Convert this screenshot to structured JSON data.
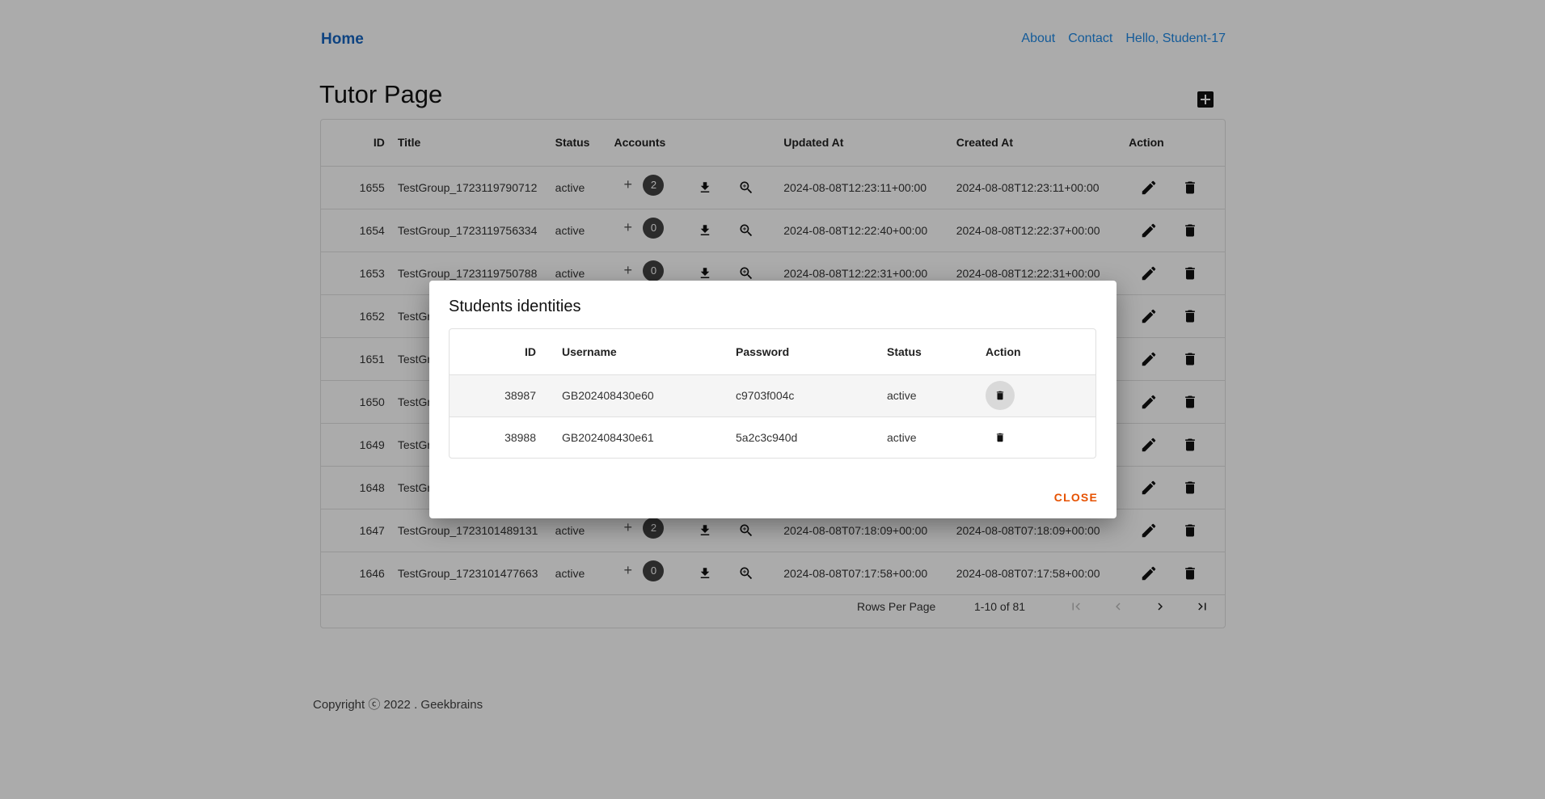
{
  "nav": {
    "home": "Home",
    "about": "About",
    "contact": "Contact",
    "greeting": "Hello, Student-17"
  },
  "page_title": "Tutor Page",
  "table": {
    "headers": {
      "id": "ID",
      "title": "Title",
      "status": "Status",
      "accounts": "Accounts",
      "updated": "Updated At",
      "created": "Created At",
      "action": "Action"
    },
    "rows": [
      {
        "id": "1655",
        "title": "TestGroup_1723119790712",
        "status": "active",
        "count": "2",
        "updated": "2024-08-08T12:23:11+00:00",
        "created": "2024-08-08T12:23:11+00:00"
      },
      {
        "id": "1654",
        "title": "TestGroup_1723119756334",
        "status": "active",
        "count": "0",
        "updated": "2024-08-08T12:22:40+00:00",
        "created": "2024-08-08T12:22:37+00:00"
      },
      {
        "id": "1653",
        "title": "TestGroup_1723119750788",
        "status": "active",
        "count": "0",
        "updated": "2024-08-08T12:22:31+00:00",
        "created": "2024-08-08T12:22:31+00:00"
      },
      {
        "id": "1652",
        "title": "TestGroup_",
        "status": "",
        "count": "",
        "updated": "",
        "created": ""
      },
      {
        "id": "1651",
        "title": "TestGroup_",
        "status": "",
        "count": "",
        "updated": "",
        "created": ""
      },
      {
        "id": "1650",
        "title": "TestGroup_",
        "status": "",
        "count": "",
        "updated": "",
        "created": ""
      },
      {
        "id": "1649",
        "title": "TestGroup_",
        "status": "",
        "count": "",
        "updated": "",
        "created": ""
      },
      {
        "id": "1648",
        "title": "TestGroup_",
        "status": "",
        "count": "",
        "updated": "",
        "created": ""
      },
      {
        "id": "1647",
        "title": "TestGroup_1723101489131",
        "status": "active",
        "count": "2",
        "updated": "2024-08-08T07:18:09+00:00",
        "created": "2024-08-08T07:18:09+00:00"
      },
      {
        "id": "1646",
        "title": "TestGroup_1723101477663",
        "status": "active",
        "count": "0",
        "updated": "2024-08-08T07:17:58+00:00",
        "created": "2024-08-08T07:17:58+00:00"
      }
    ]
  },
  "pager": {
    "rows_per_page": "Rows Per Page",
    "range": "1-10 of 81"
  },
  "footer": "Copyright ⓒ 2022 . Geekbrains",
  "dialog": {
    "title": "Students identities",
    "headers": {
      "id": "ID",
      "username": "Username",
      "password": "Password",
      "status": "Status",
      "action": "Action"
    },
    "rows": [
      {
        "id": "38987",
        "username": "GB202408430e60",
        "password": "c9703f004c",
        "status": "active"
      },
      {
        "id": "38988",
        "username": "GB202408430e61",
        "password": "5a2c3c940d",
        "status": "active"
      }
    ],
    "close": "CLOSE"
  },
  "colors": {
    "link": "#1e88e5",
    "home": "#1565c0",
    "close": "#e65100",
    "badge": "#424242"
  }
}
